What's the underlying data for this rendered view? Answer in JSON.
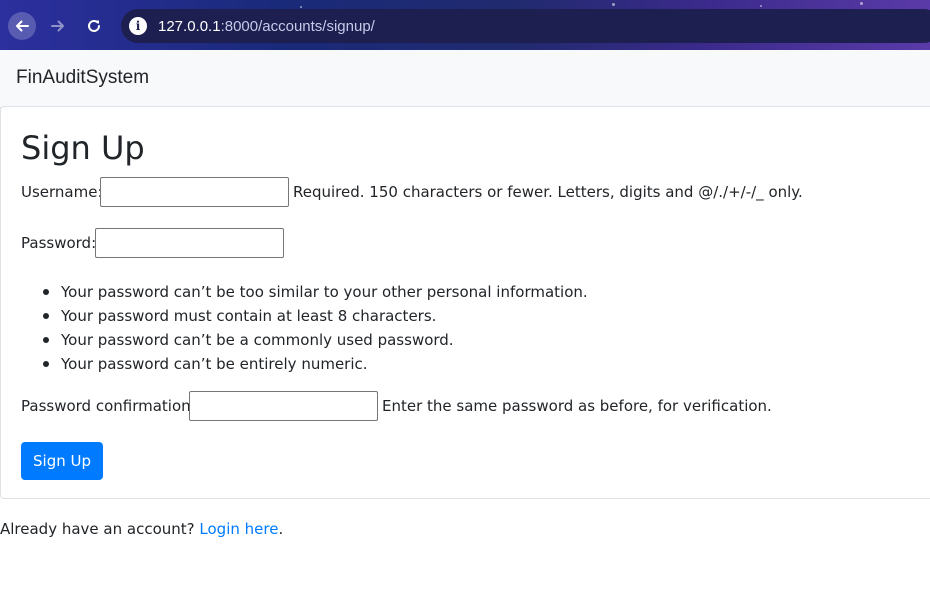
{
  "browser": {
    "url_host": "127.0.0.1",
    "url_rest": ":8000/accounts/signup/",
    "icons": {
      "back": "arrow-left-icon",
      "forward": "arrow-right-icon",
      "reload": "reload-icon",
      "info": "info-icon"
    }
  },
  "navbar": {
    "brand": "FinAuditSystem"
  },
  "form": {
    "title": "Sign Up",
    "username_label": "Username:",
    "username_value": "",
    "username_help": "Required. 150 characters or fewer. Letters, digits and @/./+/-/_ only.",
    "password_label": "Password:",
    "password_value": "",
    "password_rules": [
      "Your password can’t be too similar to your other personal information.",
      "Your password must contain at least 8 characters.",
      "Your password can’t be a commonly used password.",
      "Your password can’t be entirely numeric."
    ],
    "confirm_label": "Password confirmation:",
    "confirm_value": "",
    "confirm_help": "Enter the same password as before, for verification.",
    "submit_label": "Sign Up"
  },
  "footer": {
    "text": "Already have an account?",
    "link_label": "Login here",
    "period": "."
  },
  "colors": {
    "primary": "#007bff",
    "navbar_bg": "#f8f9fa",
    "text": "#212529"
  }
}
